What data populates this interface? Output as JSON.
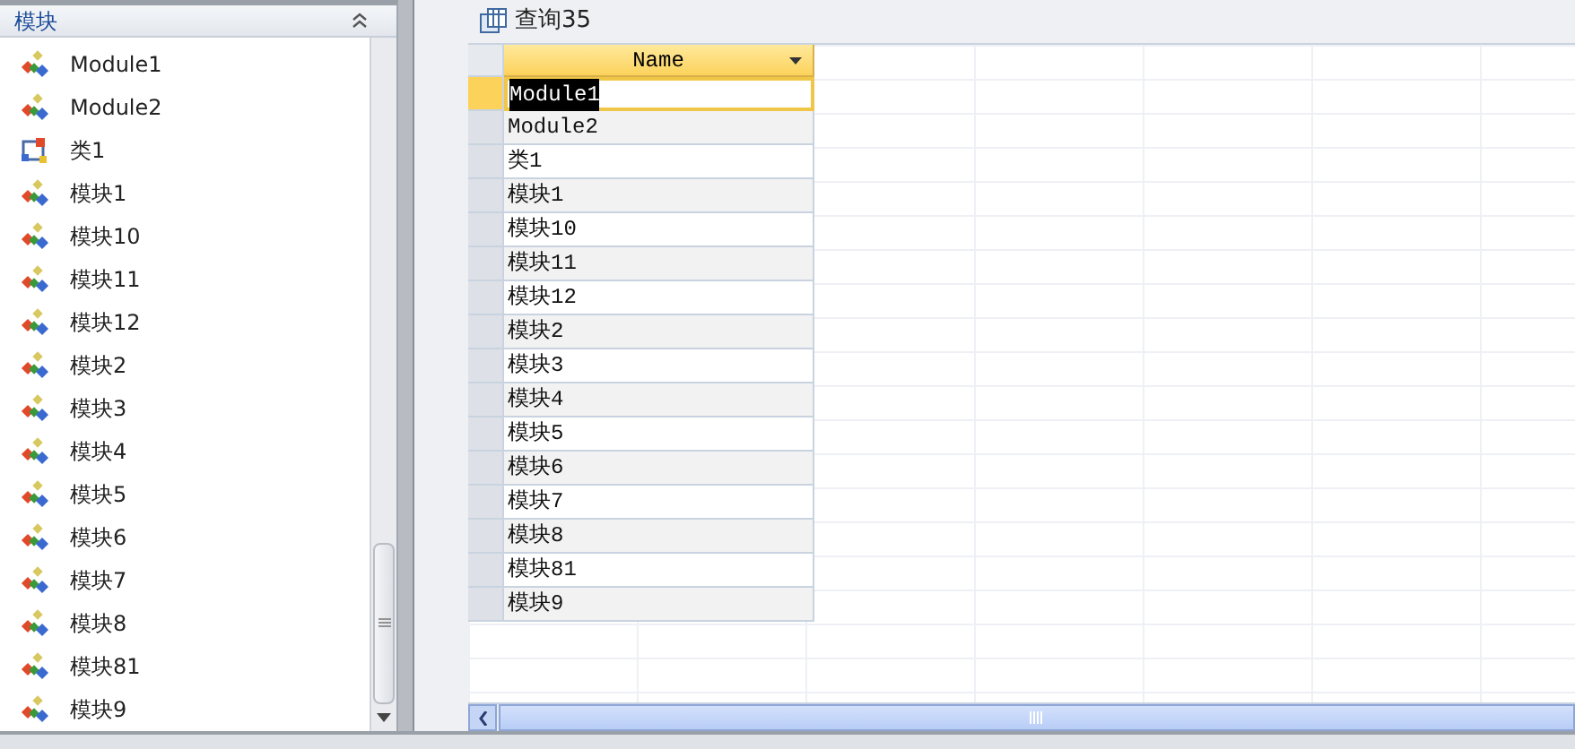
{
  "nav_pane": {
    "group": {
      "title": "模块",
      "expanded": true
    },
    "items": [
      {
        "label": "Module1",
        "kind": "module"
      },
      {
        "label": "Module2",
        "kind": "module"
      },
      {
        "label": "类1",
        "kind": "class"
      },
      {
        "label": "模块1",
        "kind": "module"
      },
      {
        "label": "模块10",
        "kind": "module"
      },
      {
        "label": "模块11",
        "kind": "module"
      },
      {
        "label": "模块12",
        "kind": "module"
      },
      {
        "label": "模块2",
        "kind": "module"
      },
      {
        "label": "模块3",
        "kind": "module"
      },
      {
        "label": "模块4",
        "kind": "module"
      },
      {
        "label": "模块5",
        "kind": "module"
      },
      {
        "label": "模块6",
        "kind": "module"
      },
      {
        "label": "模块7",
        "kind": "module"
      },
      {
        "label": "模块8",
        "kind": "module"
      },
      {
        "label": "模块81",
        "kind": "module"
      },
      {
        "label": "模块9",
        "kind": "module"
      }
    ]
  },
  "document": {
    "title": "查询35",
    "table": {
      "columns": [
        "Name"
      ],
      "rows": [
        {
          "name": "Module1",
          "selected": true
        },
        {
          "name": "Module2",
          "selected": false
        },
        {
          "name": "类1",
          "selected": false
        },
        {
          "name": "模块1",
          "selected": false
        },
        {
          "name": "模块10",
          "selected": false
        },
        {
          "name": "模块11",
          "selected": false
        },
        {
          "name": "模块12",
          "selected": false
        },
        {
          "name": "模块2",
          "selected": false
        },
        {
          "name": "模块3",
          "selected": false
        },
        {
          "name": "模块4",
          "selected": false
        },
        {
          "name": "模块5",
          "selected": false
        },
        {
          "name": "模块6",
          "selected": false
        },
        {
          "name": "模块7",
          "selected": false
        },
        {
          "name": "模块8",
          "selected": false
        },
        {
          "name": "模块81",
          "selected": false
        },
        {
          "name": "模块9",
          "selected": false
        }
      ]
    }
  }
}
